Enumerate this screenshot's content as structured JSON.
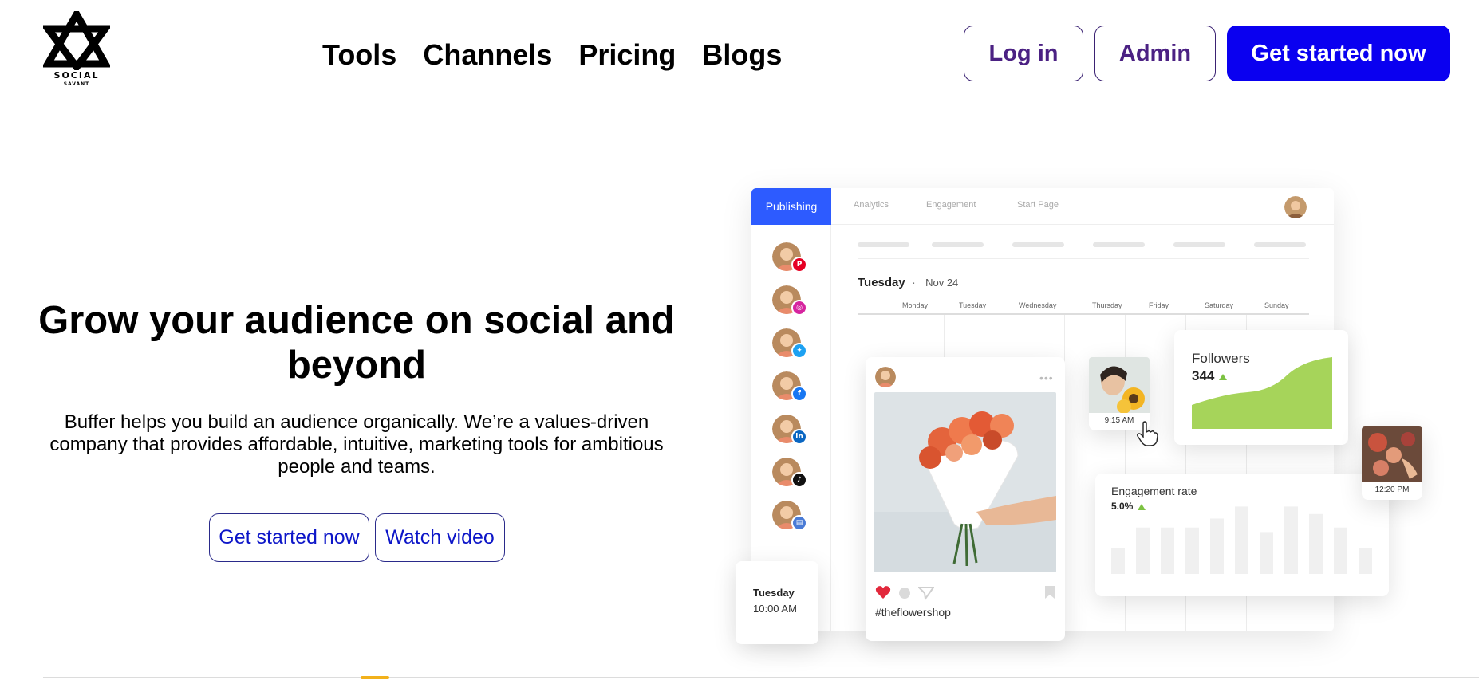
{
  "brand": {
    "name": "SOCIAL",
    "sub": "SAVANT"
  },
  "nav": {
    "items": [
      "Tools",
      "Channels",
      "Pricing",
      "Blogs"
    ]
  },
  "header": {
    "login_label": "Log in",
    "admin_label": "Admin",
    "cta_label": "Get started now"
  },
  "hero": {
    "title": "Grow your audience on social and beyond",
    "subtitle": "Buffer helps you build an audience organically. We’re a values-driven company that provides affordable, intuitive, marketing tools for ambitious people and teams.",
    "primary_label": "Get started now",
    "secondary_label": "Watch video"
  },
  "colors": {
    "primary": "#0a00f0",
    "outline_text": "#4b2183",
    "hero_link": "#0d16c8",
    "publishing_tab": "#2d5bff",
    "growth_green": "#a6d45a"
  },
  "mockup": {
    "tabs": {
      "active": "Publishing",
      "others": [
        "Analytics",
        "Engagement",
        "Start Page"
      ]
    },
    "date": {
      "day": "Tuesday",
      "sep": "·",
      "date": "Nov 24"
    },
    "weekdays": [
      "Monday",
      "Tuesday",
      "Wednesday",
      "Thursday",
      "Friday",
      "Saturday",
      "Sunday"
    ],
    "channels": [
      {
        "network": "pinterest-icon",
        "color": "#e60023"
      },
      {
        "network": "instagram-icon",
        "color": "#d6249f"
      },
      {
        "network": "twitter-icon",
        "color": "#1da1f2"
      },
      {
        "network": "facebook-icon",
        "color": "#1877f2"
      },
      {
        "network": "linkedin-icon",
        "color": "#0a66c2"
      },
      {
        "network": "tiktok-icon",
        "color": "#111111"
      },
      {
        "network": "google-business-icon",
        "color": "#4a7bd6"
      }
    ],
    "post": {
      "hashtag": "#theflowershop"
    },
    "schedule_card": {
      "day": "Tuesday",
      "time": "10:00 AM"
    },
    "thumb_1": {
      "time": "9:15 AM"
    },
    "thumb_2": {
      "time": "12:20 PM"
    },
    "followers": {
      "label": "Followers",
      "value": "344"
    },
    "engagement": {
      "label": "Engagement rate",
      "value": "5.0%",
      "bars": [
        0.34,
        0.62,
        0.62,
        0.62,
        0.74,
        0.9,
        0.56,
        0.9,
        0.8,
        0.62,
        0.34
      ]
    }
  }
}
